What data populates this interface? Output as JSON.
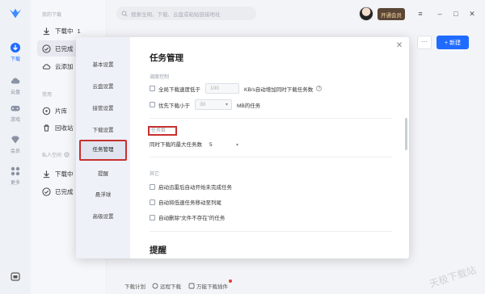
{
  "rail": {
    "items": [
      {
        "label": "下载",
        "icon": "download-icon"
      },
      {
        "label": "云盘",
        "icon": "cloud-icon"
      },
      {
        "label": "游戏",
        "icon": "gamepad-icon"
      },
      {
        "label": "会员",
        "icon": "diamond-icon"
      },
      {
        "label": "更多",
        "icon": "grid-icon"
      }
    ]
  },
  "sidebar": {
    "group_my_download": "我的下载",
    "downloading_label": "下载中",
    "downloading_count": "1",
    "completed_label": "已完成",
    "cloud_add_label": "云添加",
    "group_common": "常用",
    "library_label": "片库",
    "recycle_label": "回收站",
    "group_private": "私人空间",
    "private_downloading_label": "下载中",
    "private_completed_label": "已完成"
  },
  "topbar": {
    "search_placeholder": "搜索全网、下载、云盘或粘贴链接地址",
    "vip_label": "开通会员",
    "new_label": "+ 新建",
    "more_label": "···"
  },
  "modal": {
    "nav": [
      {
        "label": "基本设置"
      },
      {
        "label": "云盘设置"
      },
      {
        "label": "接管设置"
      },
      {
        "label": "下载设置"
      },
      {
        "label": "任务管理"
      },
      {
        "label": "提醒"
      },
      {
        "label": "悬浮球"
      },
      {
        "label": "高级设置"
      }
    ],
    "title": "任务管理",
    "speed_section": "调度控制",
    "speed_row_prefix": "全局下载速度低于",
    "speed_value": "100",
    "speed_row_suffix": "KB/s自动增加同时下载任务数",
    "priority_row_prefix": "优先下载小于",
    "priority_value": "30",
    "priority_row_suffix": "MB的任务",
    "task_count_section": "任务数",
    "task_count_label": "同时下载的最大任务数",
    "task_count_value": "5",
    "other_section": "其它",
    "opt1": "启动迅雷后自动开始未完成任务",
    "opt2": "自动将低速任务移动至列尾",
    "opt3": "自动删除“文件不存在”的任务",
    "next_title": "提醒"
  },
  "footer": {
    "plan_label": "下载计划",
    "remote_label": "远程下载",
    "plugin_label": "万能下载插件"
  },
  "watermark": "天极下载站",
  "colors": {
    "accent": "#1f6bff",
    "highlight_red": "#c7302f",
    "vip_bg": "#5b4636"
  }
}
